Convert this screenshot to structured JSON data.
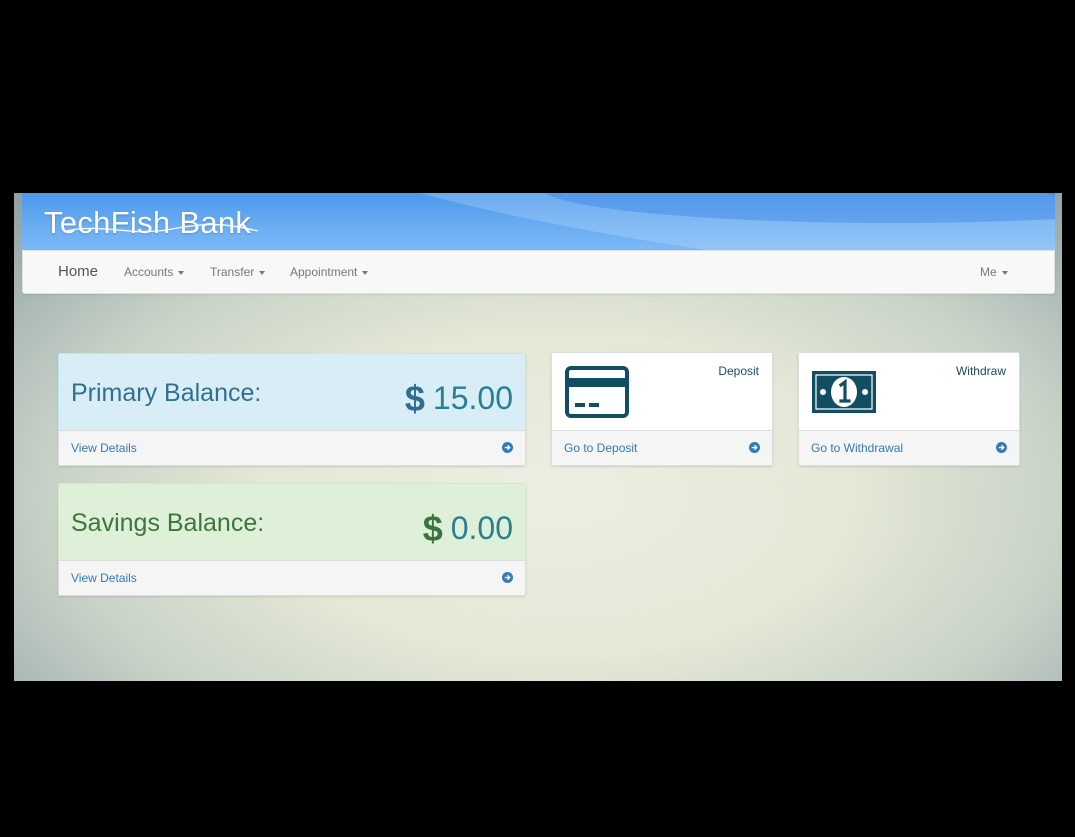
{
  "brand": {
    "name": "TechFish Bank"
  },
  "nav": {
    "home": "Home",
    "accounts": "Accounts",
    "transfer": "Transfer",
    "appointment": "Appointment",
    "me": "Me"
  },
  "balances": {
    "primary": {
      "label": "Primary Balance:",
      "currency": "$",
      "amount": "15.00",
      "link": "View Details"
    },
    "savings": {
      "label": "Savings Balance:",
      "currency": "$",
      "amount": "0.00",
      "link": "View Details"
    }
  },
  "actions": {
    "deposit": {
      "title": "Deposit",
      "link": "Go to Deposit",
      "icon": "credit-card-icon"
    },
    "withdraw": {
      "title": "Withdraw",
      "link": "Go to Withdrawal",
      "icon": "money-bill-icon"
    }
  },
  "colors": {
    "link": "#337ab7",
    "primary_panel_bg": "#d9edf7",
    "savings_panel_bg": "#dff0d8",
    "icon": "#124e63",
    "banner": "#5aa2ef"
  }
}
